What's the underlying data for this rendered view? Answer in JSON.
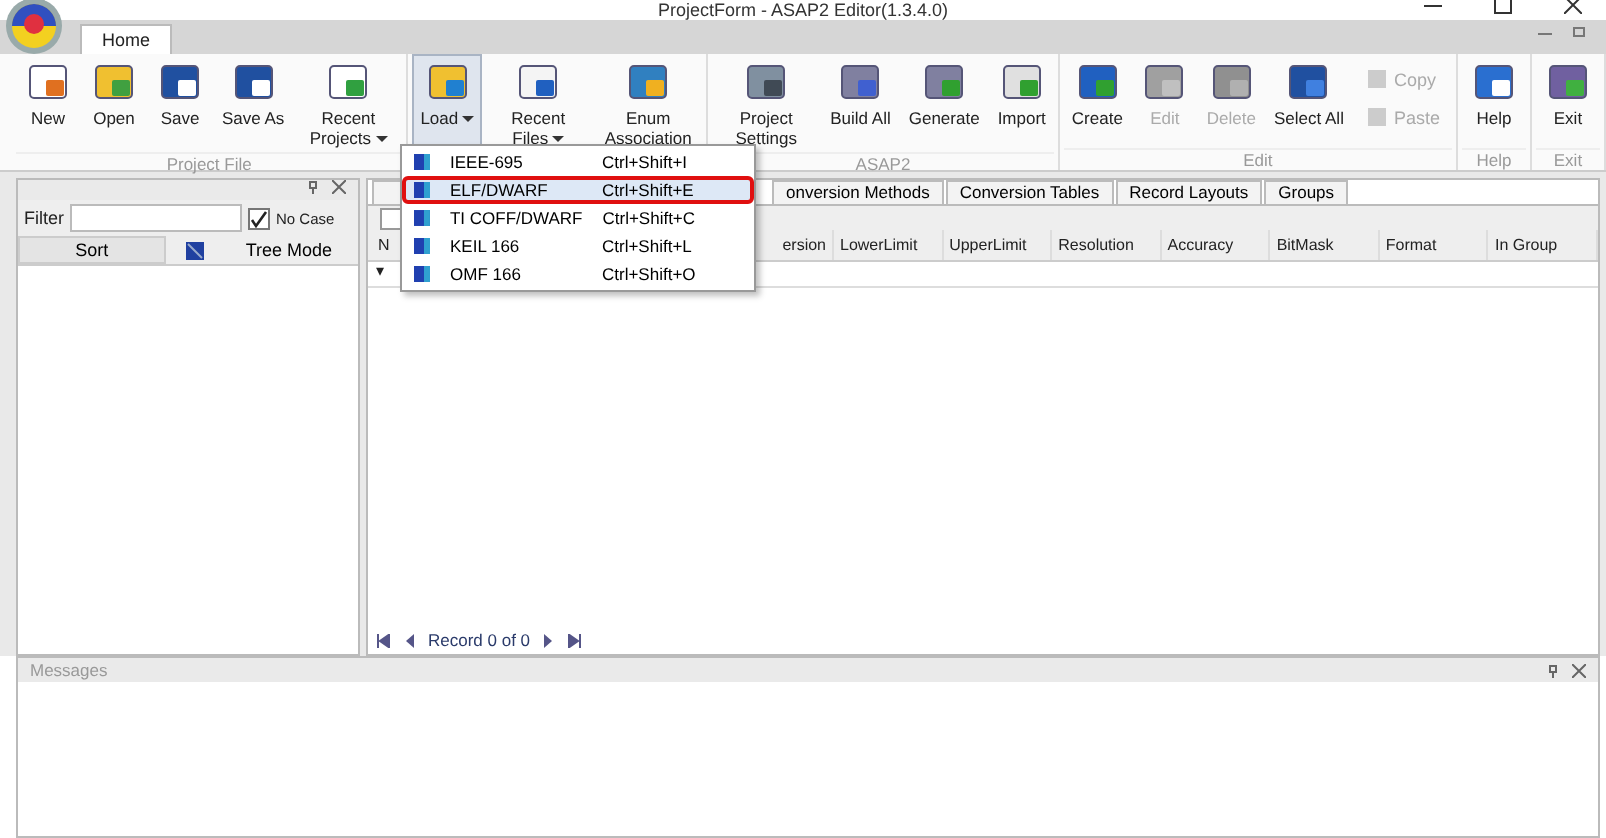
{
  "window": {
    "title": "ProjectForm - ASAP2 Editor(1.3.4.0)"
  },
  "ribbon_tab": {
    "label": "Home",
    "selected": true
  },
  "ribbon": {
    "groups": [
      {
        "label": "Project File",
        "buttons": [
          {
            "label": "New",
            "disabled": false
          },
          {
            "label": "Open",
            "disabled": false
          },
          {
            "label": "Save",
            "disabled": false
          },
          {
            "label": "Save As",
            "disabled": false
          },
          {
            "label": "Recent Projects",
            "disabled": false,
            "dropdown": true
          }
        ]
      },
      {
        "buttons": [
          {
            "label": "Load",
            "disabled": false,
            "dropdown": true,
            "pressed": true
          },
          {
            "label": "Recent Files",
            "disabled": false,
            "dropdown": true
          },
          {
            "label": "Enum Association",
            "disabled": false
          }
        ]
      },
      {
        "label": "ASAP2",
        "buttons": [
          {
            "label": "Project Settings",
            "disabled": false
          },
          {
            "label": "Build All",
            "disabled": false
          },
          {
            "label": "Generate",
            "disabled": false
          },
          {
            "label": "Import",
            "disabled": false
          }
        ]
      },
      {
        "label": "Edit",
        "buttons": [
          {
            "label": "Create",
            "disabled": false
          },
          {
            "label": "Edit",
            "disabled": true
          },
          {
            "label": "Delete",
            "disabled": true
          },
          {
            "label": "Select All",
            "disabled": false
          }
        ],
        "small_buttons": [
          {
            "label": "Copy",
            "disabled": true
          },
          {
            "label": "Paste",
            "disabled": true
          }
        ]
      },
      {
        "label": "Help",
        "buttons": [
          {
            "label": "Help",
            "disabled": false
          }
        ]
      },
      {
        "label": "Exit",
        "buttons": [
          {
            "label": "Exit",
            "disabled": false
          }
        ]
      }
    ]
  },
  "load_menu": [
    {
      "label": "IEEE-695",
      "shortcut": "Ctrl+Shift+I",
      "selected": false
    },
    {
      "label": "ELF/DWARF",
      "shortcut": "Ctrl+Shift+E",
      "selected": true
    },
    {
      "label": "TI COFF/DWARF",
      "shortcut": "Ctrl+Shift+C",
      "selected": false
    },
    {
      "label": "KEIL 166",
      "shortcut": "Ctrl+Shift+L",
      "selected": false
    },
    {
      "label": "OMF 166",
      "shortcut": "Ctrl+Shift+O",
      "selected": false
    }
  ],
  "left_panel": {
    "filter_label": "Filter",
    "no_case": {
      "label": "No Case",
      "checked": true
    },
    "sort_label": "Sort",
    "tree_mode_label": "Tree Mode"
  },
  "tabs": [
    {
      "label": "onversion Methods",
      "selected": false
    },
    {
      "label": "Conversion Tables",
      "selected": false
    },
    {
      "label": "Record Layouts",
      "selected": false
    },
    {
      "label": "Groups",
      "selected": false
    }
  ],
  "grid": {
    "columns": [
      "N",
      "ersion",
      "LowerLimit",
      "UpperLimit",
      "Resolution",
      "Accuracy",
      "BitMask",
      "Format",
      "In Group"
    ],
    "new_row_marker": "▾",
    "select_all_checked": false
  },
  "pager": {
    "text": "Record 0 of 0"
  },
  "messages": {
    "title": "Messages"
  }
}
